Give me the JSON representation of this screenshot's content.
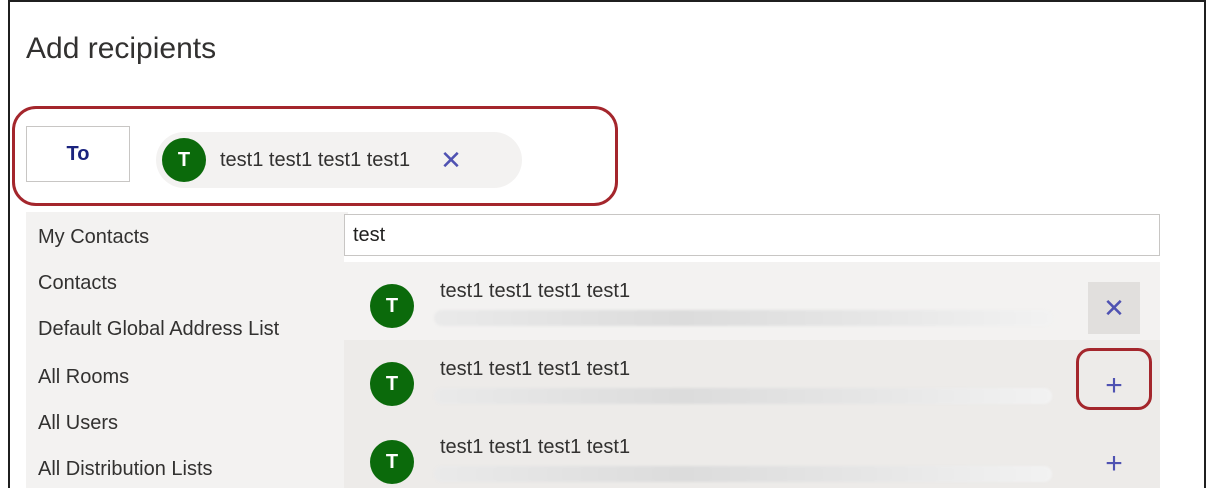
{
  "dialog": {
    "title": "Add recipients"
  },
  "to_field": {
    "button_label": "To",
    "chips": [
      {
        "initial": "T",
        "name": "test1 test1 test1 test1",
        "remove_icon": "close-icon"
      }
    ]
  },
  "left_nav": {
    "items": [
      {
        "label": "My Contacts"
      },
      {
        "label": "Contacts"
      },
      {
        "label": "Default Global Address List"
      },
      {
        "label": "All Rooms"
      },
      {
        "label": "All Users"
      },
      {
        "label": "All Distribution Lists"
      }
    ]
  },
  "search": {
    "value": "test"
  },
  "results": [
    {
      "initial": "T",
      "name": "test1 test1 test1 test1",
      "action": "remove",
      "action_icon": "close-icon"
    },
    {
      "initial": "T",
      "name": "test1 test1 test1 test1",
      "action": "add",
      "action_icon": "plus-icon"
    },
    {
      "initial": "T",
      "name": "test1 test1 test1 test1",
      "action": "add",
      "action_icon": "plus-icon"
    }
  ],
  "colors": {
    "avatar": "#0b6a0b",
    "accent": "#4f52b2",
    "highlight": "#a4262c"
  }
}
